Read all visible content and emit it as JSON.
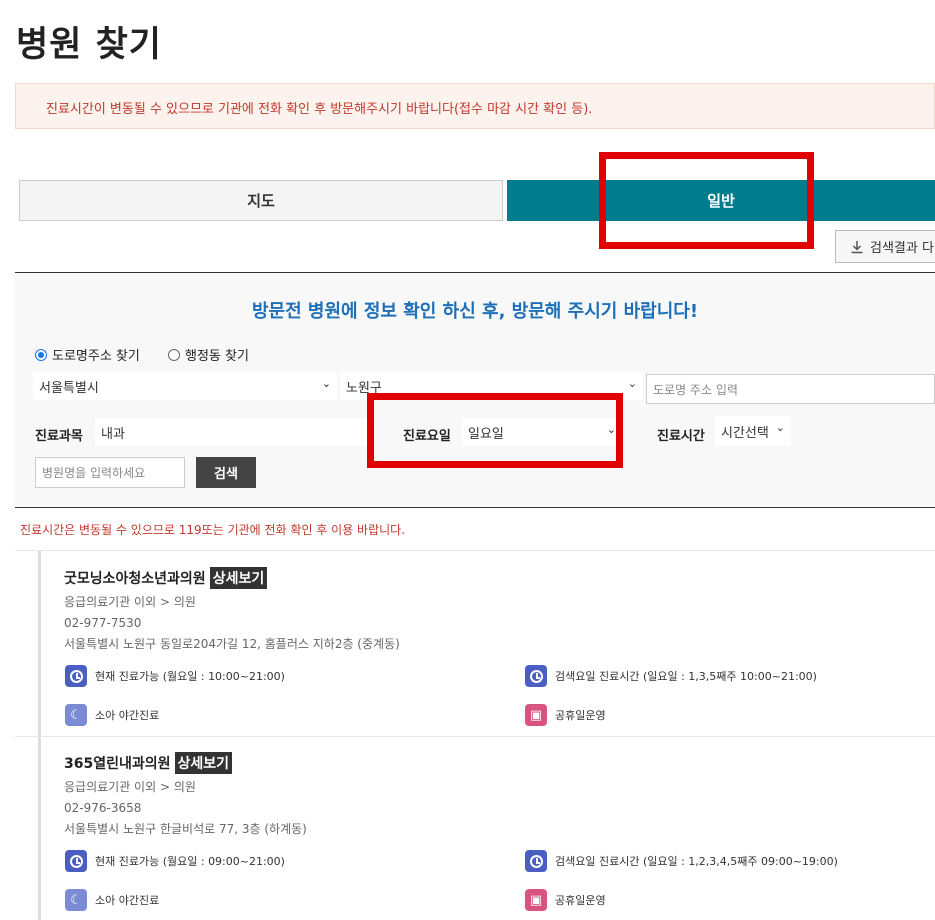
{
  "page": {
    "title": "병원 찾기"
  },
  "notice": "진료시간이 변동될 수 있으므로 기관에 전화 확인 후 방문해주시기 바랍니다(접수 마감 시간 확인 등).",
  "tabs": {
    "map": "지도",
    "general": "일반"
  },
  "download": {
    "label": "검색결과 다",
    "icon": "download-icon"
  },
  "search": {
    "heading": "방문전 병원에 정보 확인 하신 후, 방문해 주시기 바랍니다!",
    "radio_road": "도로명주소 찾기",
    "radio_admin": "행정동 찾기",
    "city": "서울특별시",
    "district": "노원구",
    "road_placeholder": "도로명 주소 입력",
    "dept_label": "진료과목",
    "dept_value": "내과",
    "day_label": "진료요일",
    "day_value": "일요일",
    "time_label": "진료시간",
    "time_value": "시간선택",
    "name_placeholder": "병원명을 입력하세요",
    "search_button": "검색"
  },
  "warning": "진료시간은 변동될 수 있으므로 119또는 기관에 전화 확인 후 이용 바랍니다.",
  "hospitals": [
    {
      "name": "굿모닝소아청소년과의원",
      "detail": "상세보기",
      "category": "응급의료기관 이외 > 의원",
      "phone": "02-977-7530",
      "address": "서울특별시 노원구 동일로204가길 12, 홈플러스 지하2층 (중계동)",
      "now_hours": "현재 진료가능 (월요일 : 10:00~21:00)",
      "search_hours": "검색요일 진료시간 (일요일 : 1,3,5째주 10:00~21:00)",
      "night": "소아 야간진료",
      "holiday": "공휴일운영"
    },
    {
      "name": "365열린내과의원",
      "detail": "상세보기",
      "category": "응급의료기관 이외 > 의원",
      "phone": "02-976-3658",
      "address": "서울특별시 노원구 한글비석로 77, 3층 (하계동)",
      "now_hours": "현재 진료가능 (월요일 : 09:00~21:00)",
      "search_hours": "검색요일 진료시간 (일요일 : 1,2,3,4,5째주 09:00~19:00)",
      "night": "소아 야간진료",
      "holiday": "공휴일운영"
    }
  ],
  "colors": {
    "accent": "#007c8f",
    "highlight": "#e10000",
    "heading": "#1d6fb8"
  }
}
